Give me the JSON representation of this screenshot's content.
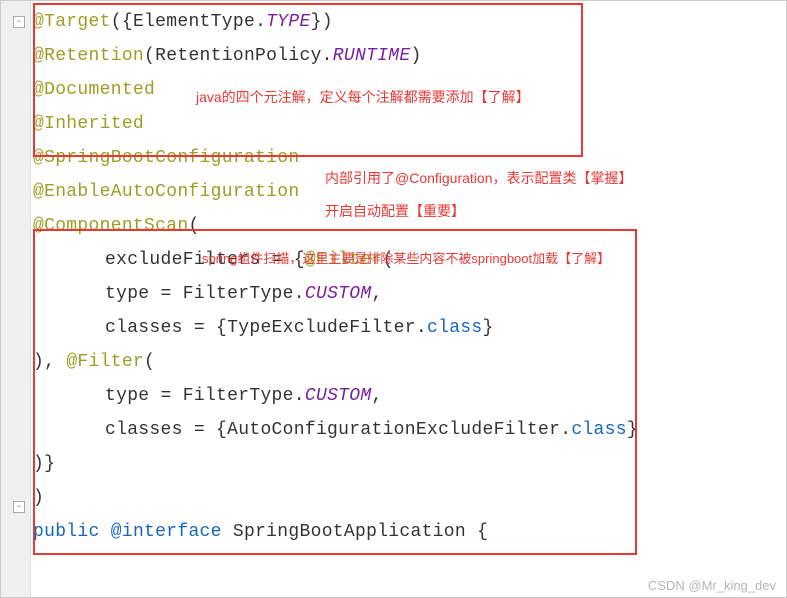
{
  "lines": {
    "l1": {
      "anno": "@Target",
      "open": "({",
      "id1": "ElementType",
      "dot": ".",
      "const1": "TYPE",
      "close": "})"
    },
    "l2": {
      "anno": "@Retention",
      "open": "(",
      "id1": "RetentionPolicy",
      "dot": ".",
      "const1": "RUNTIME",
      "close": ")"
    },
    "l3": {
      "anno": "@Documented"
    },
    "l4": {
      "anno": "@Inherited"
    },
    "l5": {
      "anno": "@SpringBootConfiguration"
    },
    "l6": {
      "anno": "@EnableAutoConfiguration"
    },
    "l7": {
      "anno": "@ComponentScan",
      "open": "("
    },
    "l8": {
      "id": "excludeFilters",
      "eq": " = {",
      "anno": "@Filter",
      "open": "("
    },
    "l9": {
      "id": "type",
      "eq": " = ",
      "cls": "FilterType",
      "dot": ".",
      "const1": "CUSTOM",
      "comma": ","
    },
    "l10": {
      "id": "classes",
      "eq": " = {",
      "cls": "TypeExcludeFilter",
      "dot": ".",
      "kw": "class",
      "close": "}"
    },
    "l11": {
      "punct": "), ",
      "anno": "@Filter",
      "open": "("
    },
    "l12": {
      "id": "type",
      "eq": " = ",
      "cls": "FilterType",
      "dot": ".",
      "const1": "CUSTOM",
      "comma": ","
    },
    "l13": {
      "id": "classes",
      "eq": " = {",
      "cls": "AutoConfigurationExcludeFilter",
      "dot": ".",
      "kw": "class",
      "close": "}"
    },
    "l14": {
      "punct": ")}"
    },
    "l15": {
      "punct": ")"
    },
    "l16": {
      "kw1": "public",
      "anno": "@interface",
      "cls": "SpringBootApplication",
      "open": " {"
    }
  },
  "notes": {
    "n1": "java的四个元注解，定义每个注解都需要添加【了解】",
    "n2": "内部引用了@Configuration，表示配置类【掌握】",
    "n3": "开启自动配置【重要】",
    "n4": "spring组件扫描，这里主要是排除某些内容不被springboot加载【了解】"
  },
  "watermark": "CSDN @Mr_king_dev"
}
